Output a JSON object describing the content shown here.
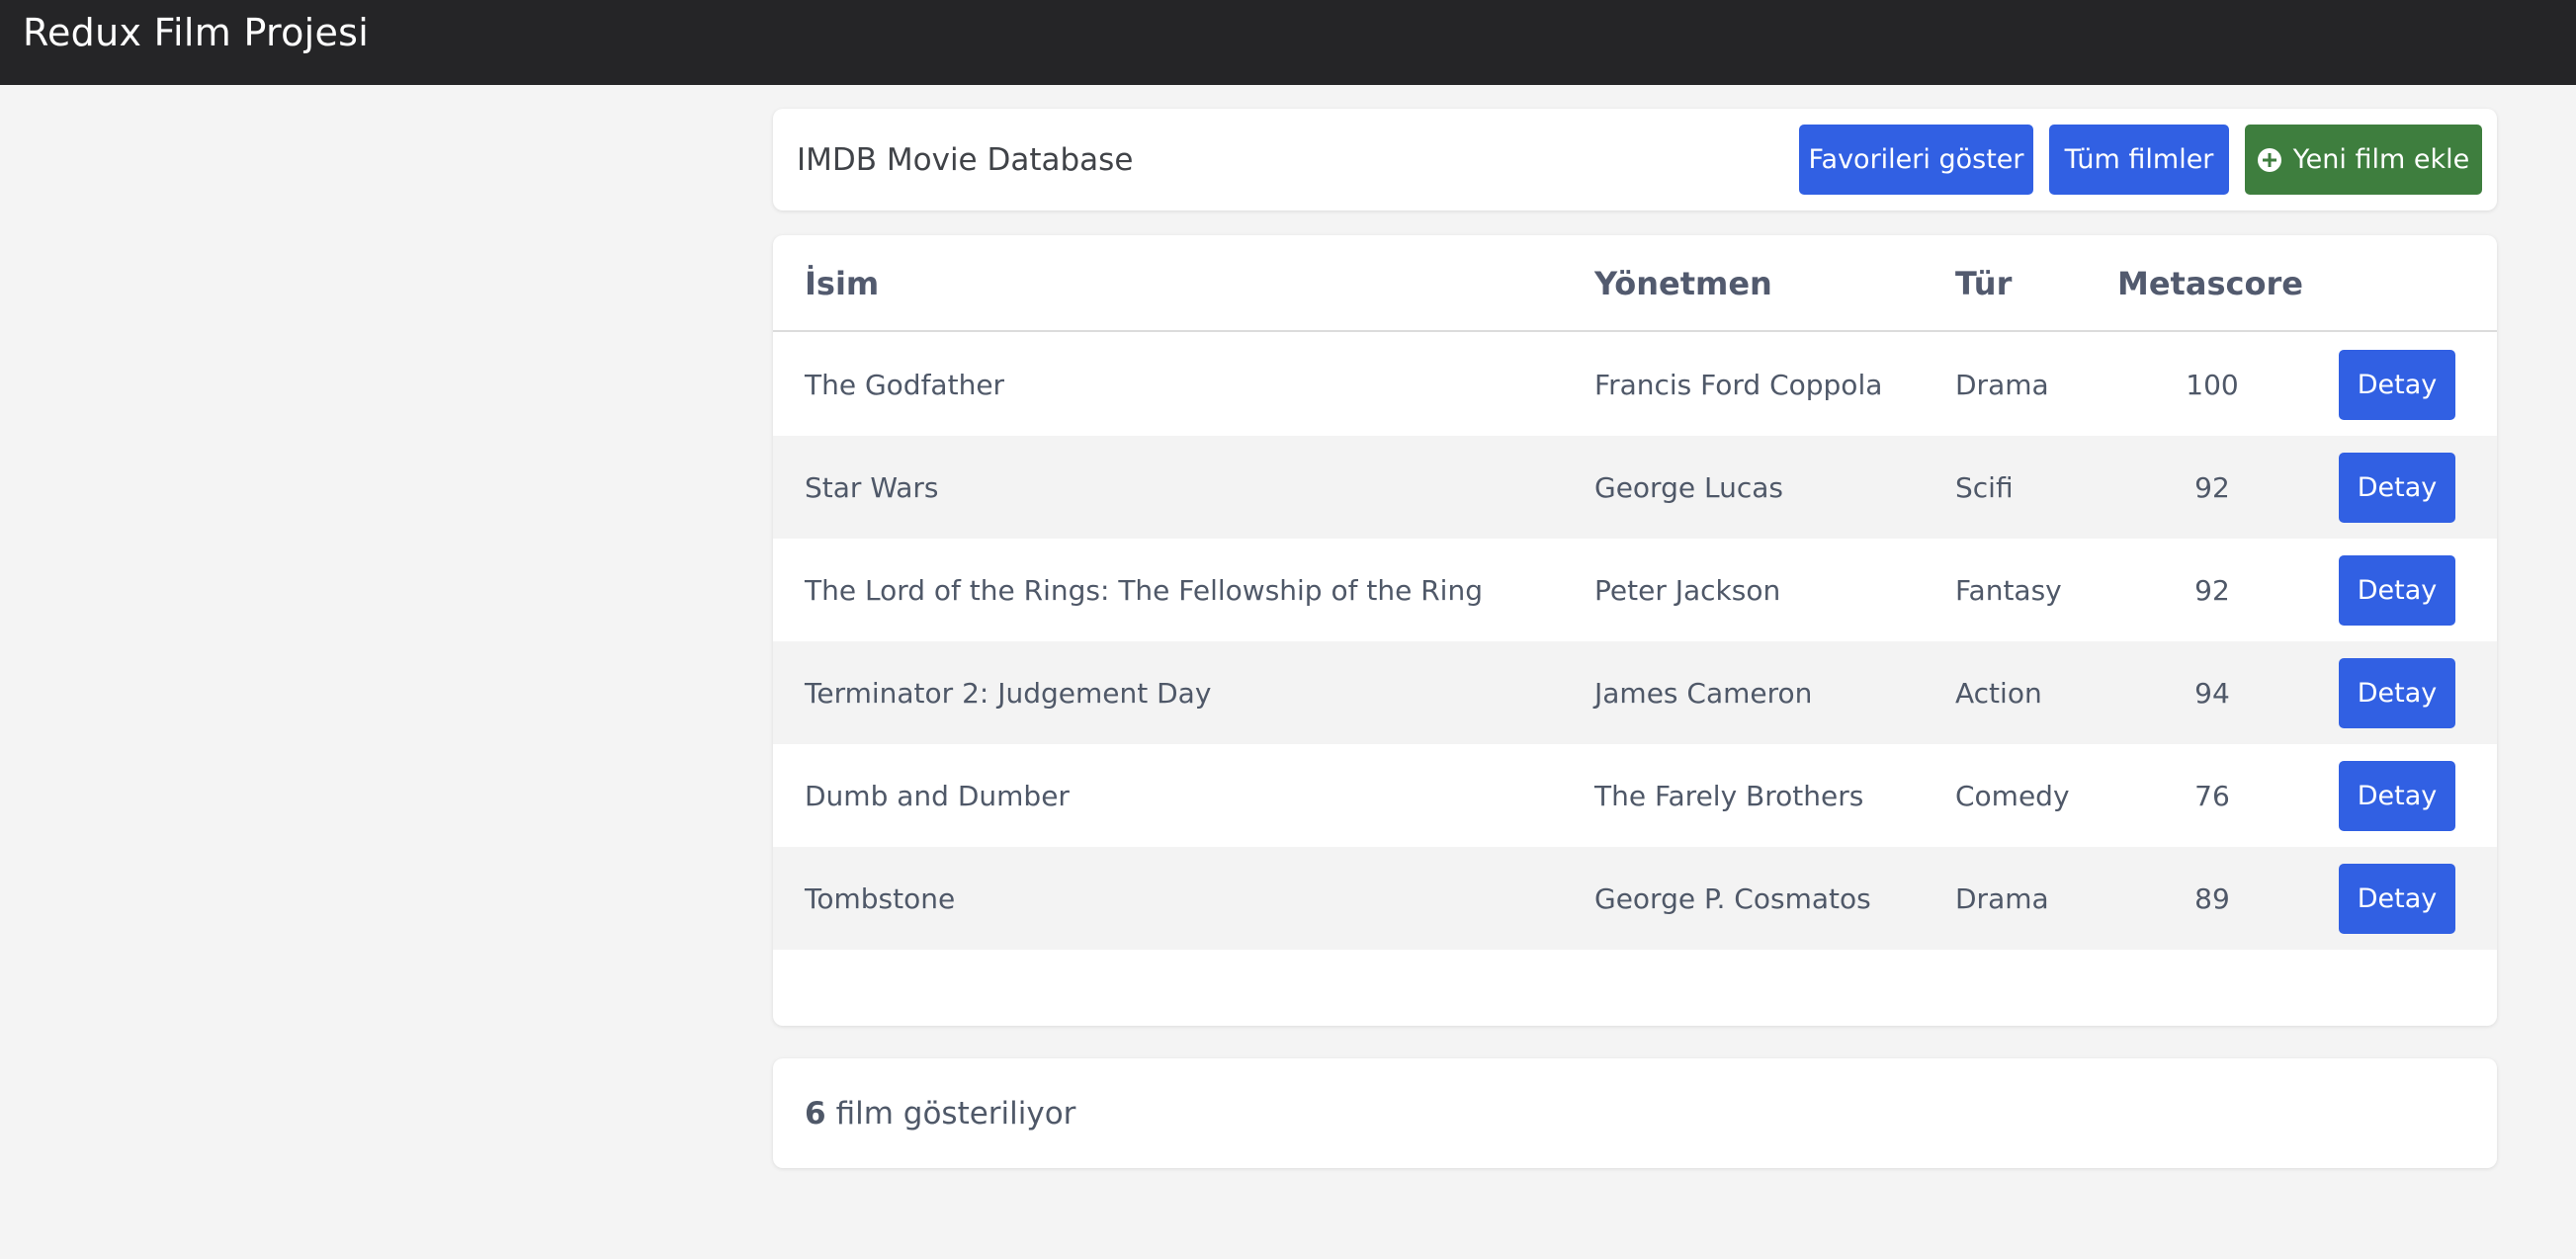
{
  "navbar": {
    "brand": "Redux Film Projesi"
  },
  "header": {
    "title": "IMDB Movie Database",
    "favorites_label": "Favorileri göster",
    "all_movies_label": "Tüm filmler",
    "add_movie_label": "Yeni film ekle"
  },
  "table": {
    "columns": [
      "İsim",
      "Yönetmen",
      "Tür",
      "Metascore"
    ],
    "detail_label": "Detay",
    "rows": [
      {
        "name": "The Godfather",
        "director": "Francis Ford Coppola",
        "genre": "Drama",
        "metascore": "100"
      },
      {
        "name": "Star Wars",
        "director": "George Lucas",
        "genre": "Scifi",
        "metascore": "92"
      },
      {
        "name": "The Lord of the Rings: The Fellowship of the Ring",
        "director": "Peter Jackson",
        "genre": "Fantasy",
        "metascore": "92"
      },
      {
        "name": "Terminator 2: Judgement Day",
        "director": "James Cameron",
        "genre": "Action",
        "metascore": "94"
      },
      {
        "name": "Dumb and Dumber",
        "director": "The Farely Brothers",
        "genre": "Comedy",
        "metascore": "76"
      },
      {
        "name": "Tombstone",
        "director": "George P. Cosmatos",
        "genre": "Drama",
        "metascore": "89"
      }
    ]
  },
  "footer": {
    "count": "6",
    "text": "film gösteriliyor"
  },
  "colors": {
    "navbar": "#252527",
    "primary": "#3160e3",
    "success": "#3e7e3e",
    "background": "#f4f4f4"
  }
}
